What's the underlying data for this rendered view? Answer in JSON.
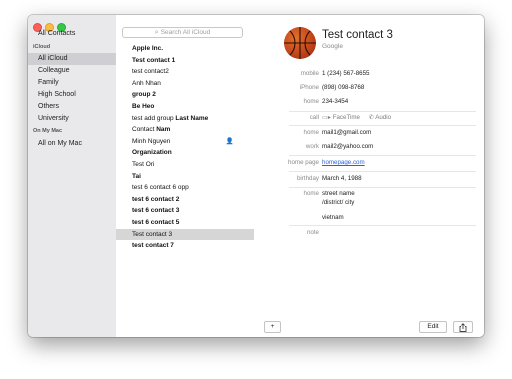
{
  "sidebar": {
    "items": [
      {
        "label": "All Contacts"
      },
      {
        "label": "All iCloud",
        "selected": true
      },
      {
        "label": "Colleague"
      },
      {
        "label": "Family"
      },
      {
        "label": "High School"
      },
      {
        "label": "Others"
      },
      {
        "label": "University"
      },
      {
        "label": "All on My Mac"
      }
    ],
    "sections": {
      "icloud": "iCloud",
      "on_my_mac": "On My Mac"
    }
  },
  "search": {
    "placeholder": "Search All iCloud",
    "icon": "search-icon"
  },
  "contacts": [
    {
      "label": "Apple Inc."
    },
    {
      "label": "Test contact 1"
    },
    {
      "label": "test contact2"
    },
    {
      "label": "Anh Nhan"
    },
    {
      "label": "group 2"
    },
    {
      "label": "Be Heo"
    },
    {
      "label_a": "test add group ",
      "label_b": "Last Name"
    },
    {
      "label_a": "Contact ",
      "label_b": "Nam"
    },
    {
      "label": "Minh Nguyen",
      "icon": "person-icon"
    },
    {
      "label": "Organization"
    },
    {
      "label": "Test Ori"
    },
    {
      "label": "Tai"
    },
    {
      "label": "test 6 contact 6 opp"
    },
    {
      "label": "test 6 contact 2"
    },
    {
      "label": "test 6 contact 3"
    },
    {
      "label": "test 6 contact 5"
    },
    {
      "label": "Test contact 3",
      "selected": true
    },
    {
      "label": "test contact 7"
    }
  ],
  "detail": {
    "name": "Test contact 3",
    "company": "Google",
    "fields": {
      "mobile": {
        "label": "mobile",
        "value": "1 (234) 567-8655"
      },
      "iphone": {
        "label": "iPhone",
        "value": "(898) 098-8768"
      },
      "home_phone": {
        "label": "home",
        "value": "234-3454"
      },
      "call": {
        "label": "call",
        "facetime": "FaceTime",
        "audio": "Audio"
      },
      "home_email": {
        "label": "home",
        "value": "mail1@gmail.com"
      },
      "work_email": {
        "label": "work",
        "value": "mail2@yahoo.com"
      },
      "homepage": {
        "label": "home page",
        "value": "homepage.com"
      },
      "birthday": {
        "label": "birthday",
        "value": "March 4, 1988"
      },
      "home_address": {
        "label": "home",
        "line1": "street name",
        "line2": "/district/ city",
        "line3": "vietnam"
      },
      "note": {
        "label": "note",
        "value": ""
      }
    }
  },
  "footer": {
    "add_label": "+",
    "edit_label": "Edit",
    "share_icon": "share-icon"
  },
  "colors": {
    "accent": "#2a62d8",
    "sidebar_selected": "#cfcfd3",
    "list_selected": "#d6d6d6"
  }
}
